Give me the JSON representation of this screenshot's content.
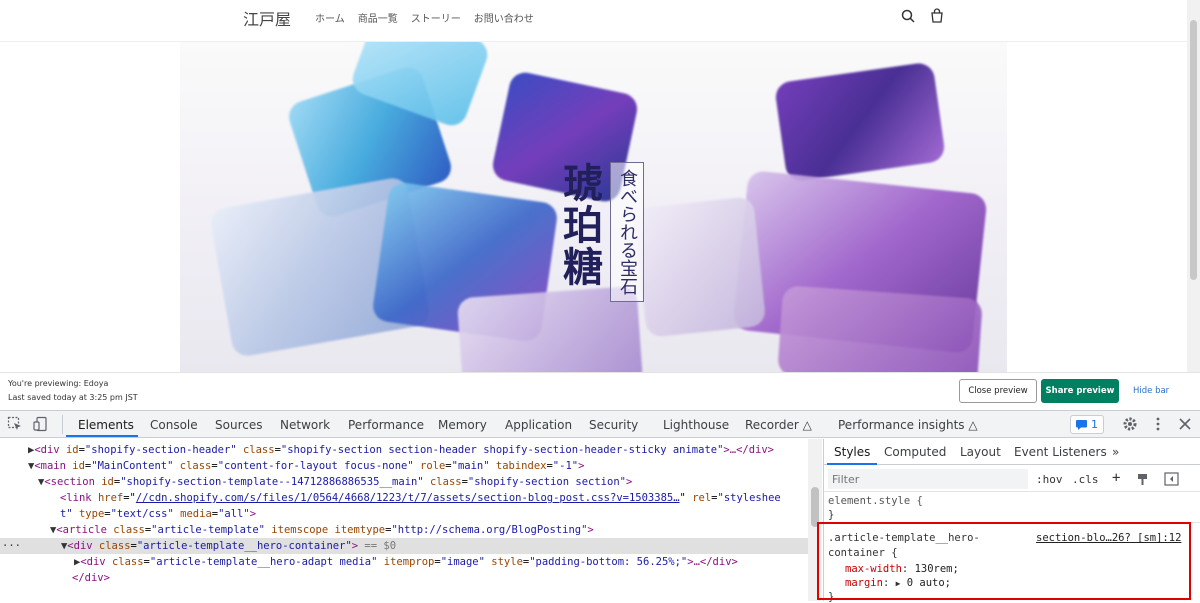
{
  "header": {
    "brand": "江戸屋",
    "nav": [
      "ホーム",
      "商品一覧",
      "ストーリー",
      "お問い合わせ"
    ]
  },
  "hero": {
    "title": "琥珀糖",
    "subtitle": "食べられる宝石"
  },
  "preview_bar": {
    "previewing_label": "You're previewing:",
    "store_name": "Edoya",
    "last_saved": "Last saved today at 3:25 pm JST",
    "close_label": "Close preview",
    "share_label": "Share preview",
    "hide_label": "Hide bar"
  },
  "devtools": {
    "tabs": [
      "Elements",
      "Console",
      "Sources",
      "Network",
      "Performance",
      "Memory",
      "Application",
      "Security",
      "Lighthouse",
      "Recorder",
      "Performance insights"
    ],
    "issues_count": "1",
    "dom": {
      "l1": {
        "open": "<div ",
        "a1": "id",
        "v1": "\"shopify-section-header\"",
        "a2": "class",
        "v2": "\"shopify-section section-header shopify-section-header-sticky animate\"",
        "close": ">…</div>"
      },
      "l2": {
        "open": "<main ",
        "a1": "id",
        "v1": "\"MainContent\"",
        "a2": "class",
        "v2": "\"content-for-layout focus-none\"",
        "a3": "role",
        "v3": "\"main\"",
        "a4": "tabindex",
        "v4": "\"-1\"",
        "close": ">"
      },
      "l3": {
        "open": "<section ",
        "a1": "id",
        "v1": "\"shopify-section-template--14712886886535__main\"",
        "a2": "class",
        "v2": "\"shopify-section section\"",
        "close": ">"
      },
      "l4": {
        "open": "<link ",
        "a1": "href",
        "v1": "//cdn.shopify.com/s/files/1/0564/4668/1223/t/7/assets/section-blog-post.css?v=1503385…",
        "a2": "rel",
        "v2": "\"styleshee"
      },
      "l5": {
        "cont": "t\"",
        "a1": "type",
        "v1": "\"text/css\"",
        "a2": "media",
        "v2": "\"all\"",
        "close": ">"
      },
      "l6": {
        "open": "<article ",
        "a1": "class",
        "v1": "\"article-template\"",
        "a2": "itemscope",
        "a3": "itemtype",
        "v3": "\"http://schema.org/BlogPosting\"",
        "close": ">"
      },
      "l7": {
        "open": "<div ",
        "a1": "class",
        "v1": "\"article-template__hero-container\"",
        "close": ">",
        "eq": " == $0"
      },
      "l8": {
        "open": "<div ",
        "a1": "class",
        "v1": "\"article-template__hero-adapt media\"",
        "a2": "itemprop",
        "v2": "\"image\"",
        "a3": "style",
        "v3": "\"padding-bottom: 56.25%;\"",
        "close": ">…</div>"
      },
      "l9": {
        "close": "</div>"
      }
    },
    "styles": {
      "tabs": [
        "Styles",
        "Computed",
        "Layout",
        "Event Listeners"
      ],
      "filter_placeholder": "Filter",
      "hov": ":hov",
      "cls": ".cls",
      "element_style": "element.style {",
      "element_close": "}",
      "rule_selector_1": ".article-template__hero-",
      "rule_selector_2": "container {",
      "rule_source": "section-blo…26? [sm]:12",
      "prop1_name": "max-width",
      "prop1_value": "130rem;",
      "prop2_name": "margin",
      "prop2_value": "0 auto;",
      "rule_close": "}"
    }
  },
  "colors": {
    "share_button": "#008060",
    "highlight_box": "#e00000",
    "devtools_accent": "#1a73e8"
  }
}
